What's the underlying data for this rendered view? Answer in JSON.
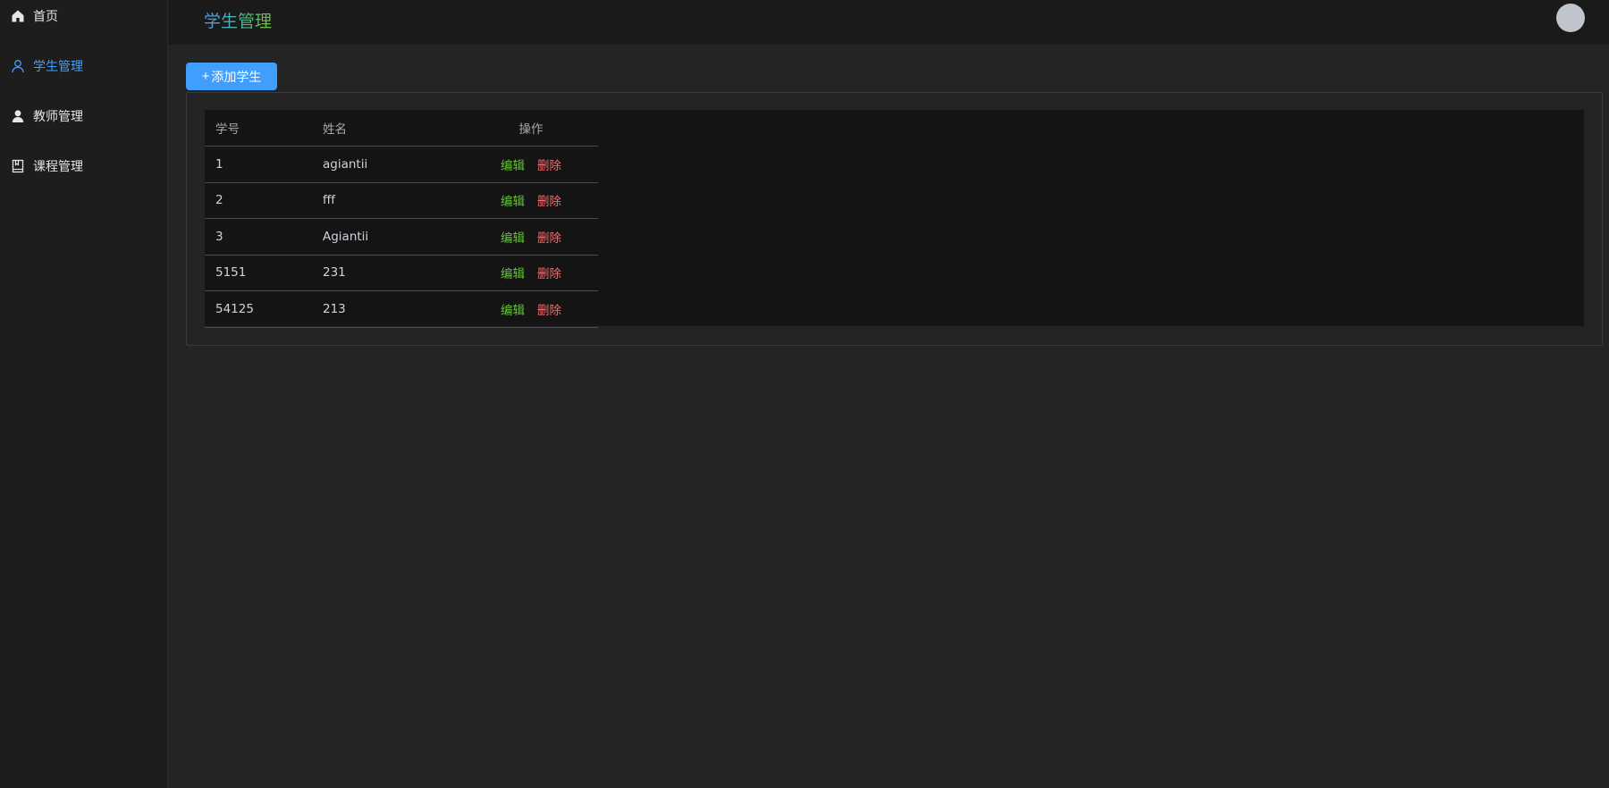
{
  "sidebar": {
    "items": [
      {
        "label": "首页",
        "icon": "home-icon",
        "active": false
      },
      {
        "label": "学生管理",
        "icon": "user-icon",
        "active": true
      },
      {
        "label": "教师管理",
        "icon": "user-filled-icon",
        "active": false
      },
      {
        "label": "课程管理",
        "icon": "book-icon",
        "active": false
      }
    ]
  },
  "header": {
    "title": "学生管理"
  },
  "toolbar": {
    "add_label": "添加学生",
    "add_icon": "+"
  },
  "table": {
    "columns": [
      "学号",
      "姓名",
      "操作"
    ],
    "rows": [
      {
        "id": "1",
        "name": "agiantii"
      },
      {
        "id": "2",
        "name": "fff"
      },
      {
        "id": "3",
        "name": "Agiantii"
      },
      {
        "id": "5151",
        "name": "231"
      },
      {
        "id": "54125",
        "name": "213"
      }
    ],
    "edit_label": "编辑",
    "delete_label": "删除"
  },
  "colors": {
    "accent": "#409eff",
    "success": "#67c23a",
    "danger": "#f56c6c"
  }
}
